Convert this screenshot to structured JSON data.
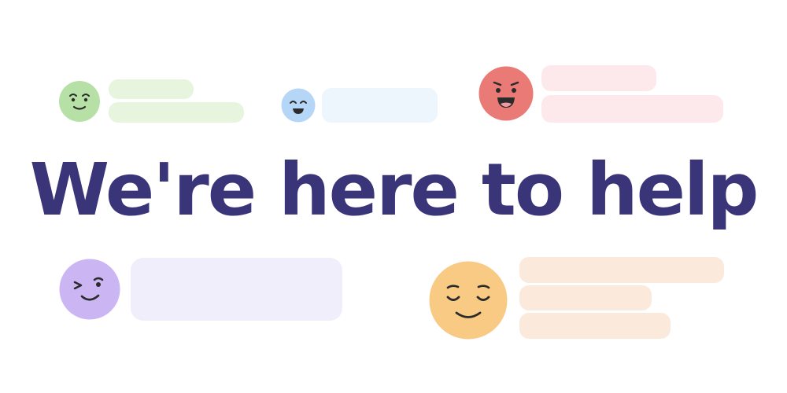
{
  "headline": "We're here to help",
  "colors": {
    "headline": "#3a3478",
    "face_stroke": "#2b2b2b",
    "green_face": "#b7e0a6",
    "green_bubble": "#e7f5de",
    "blue_face": "#b6d6f7",
    "blue_bubble": "#edf5fd",
    "red_face": "#ea7a76",
    "red_bubble": "#fde9ec",
    "purple_face": "#cbb6f3",
    "purple_bubble": "#f1eefc",
    "orange_face": "#f8ca83",
    "orange_bubble": "#fbeadb"
  },
  "faces": [
    {
      "name": "green",
      "expression": "smile-icon"
    },
    {
      "name": "blue",
      "expression": "happy-closed-eyes-icon"
    },
    {
      "name": "red",
      "expression": "laughing-icon"
    },
    {
      "name": "purple",
      "expression": "wink-icon"
    },
    {
      "name": "orange",
      "expression": "content-closed-eyes-icon"
    }
  ]
}
